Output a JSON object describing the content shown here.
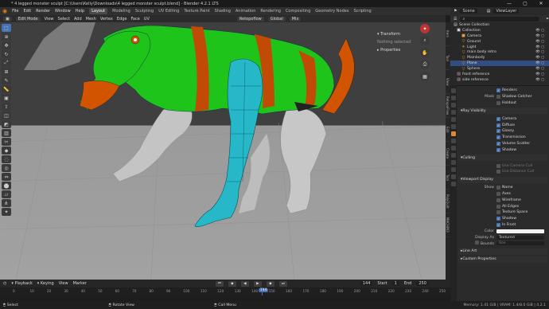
{
  "window": {
    "title": "* 4 legged monster sculpt [C:\\Users\\Kelly\\Downloads\\4 legged monster sculpt.blend] - Blender 4.2.1 LTS",
    "controls": [
      "—",
      "▢",
      "✕"
    ]
  },
  "menubar": {
    "menus": [
      "File",
      "Edit",
      "Render",
      "Window",
      "Help"
    ],
    "workspaces": [
      "Layout",
      "Modeling",
      "Sculpting",
      "UV Editing",
      "Texture Paint",
      "Shading",
      "Animation",
      "Rendering",
      "Compositing",
      "Geometry Nodes",
      "Scripting"
    ],
    "active_workspace": "Layout"
  },
  "scene_header": {
    "scene_label": "Scene",
    "view_layer_label": "ViewLayer"
  },
  "viewport_header": {
    "mode": "Edit Mode",
    "menus": [
      "View",
      "Select",
      "Add",
      "Mesh",
      "Vertex",
      "Edge",
      "Face",
      "UV"
    ],
    "transform_orientation": "Global",
    "snap": "Retopoflow",
    "proportional": "Mix"
  },
  "n_panel": {
    "transform_title": "Transform",
    "transform_note": "Nothing selected",
    "properties_title": "Properties"
  },
  "side_tabs": [
    "Item",
    "Tool",
    "View",
    "RetopoFlow",
    "Edit",
    "Create",
    "Tool",
    "PolyQuilt",
    "MACHIN3"
  ],
  "outliner": {
    "root": "Scene Collection",
    "items": [
      {
        "label": "Collection",
        "icon": "collection-icon",
        "indent": 1
      },
      {
        "label": "Camera",
        "icon": "camera-icon",
        "indent": 2
      },
      {
        "label": "Ground",
        "icon": "mesh-icon",
        "indent": 2
      },
      {
        "label": "Light",
        "icon": "light-icon",
        "indent": 2
      },
      {
        "label": "main body retro",
        "icon": "mesh-icon",
        "indent": 2
      },
      {
        "label": "Mainbody",
        "icon": "mesh-icon",
        "indent": 2
      },
      {
        "label": "Plane",
        "icon": "mesh-icon",
        "indent": 2,
        "selected": true
      },
      {
        "label": "Sphere",
        "icon": "mesh-icon",
        "indent": 2
      },
      {
        "label": "front reference",
        "icon": "image-icon",
        "indent": 1
      },
      {
        "label": "side reference",
        "icon": "image-icon",
        "indent": 1
      }
    ]
  },
  "properties": {
    "renders_label": "Renders",
    "mask_label": "Mask",
    "shadow_catcher": "Shadow Catcher",
    "holdout": "Holdout",
    "ray_visibility": "Ray Visibility",
    "ray_items": [
      "Camera",
      "Diffuse",
      "Glossy",
      "Transmission",
      "Volume Scatter",
      "Shadow"
    ],
    "culling": "Culling",
    "culling_items": [
      "Use Camera Cull",
      "Use Distance Cull"
    ],
    "viewport_display": "Viewport Display",
    "show_label": "Show",
    "show_items": [
      {
        "label": "Name",
        "checked": false
      },
      {
        "label": "Axes",
        "checked": false
      },
      {
        "label": "Wireframe",
        "checked": false
      },
      {
        "label": "All Edges",
        "checked": false
      },
      {
        "label": "Texture Space",
        "checked": false
      },
      {
        "label": "Shadow",
        "checked": true
      },
      {
        "label": "In Front",
        "checked": true
      }
    ],
    "color_label": "Color",
    "display_as_label": "Display As",
    "display_as_value": "Textured",
    "bounds_label": "Bounds",
    "bounds_value": "Box",
    "line_art": "Line Art",
    "custom_properties": "Custom Properties"
  },
  "timeline": {
    "menus": [
      "Playback",
      "Keying",
      "View",
      "Marker"
    ],
    "current_frame": "144",
    "start_label": "Start",
    "start_value": "1",
    "end_label": "End",
    "end_value": "250",
    "ticks": [
      "0",
      "10",
      "20",
      "30",
      "40",
      "50",
      "60",
      "70",
      "80",
      "90",
      "100",
      "110",
      "120",
      "130",
      "140",
      "144",
      "150",
      "160",
      "170",
      "180",
      "190",
      "200",
      "210",
      "220",
      "230",
      "240",
      "250"
    ]
  },
  "statusbar": {
    "left_action": "Select",
    "mid_action": "Rotate View",
    "right_action": "Call Menu",
    "memory": "Memory: 1.41 GiB | VRAM: 1.4/8.0 GiB | 4.2.1"
  },
  "colors": {
    "accent": "#4772b3",
    "body_green": "#1fc41a",
    "body_orange": "#d35400",
    "leg_cyan": "#26b8c8",
    "sculpt_grey": "#c7c7c7"
  }
}
